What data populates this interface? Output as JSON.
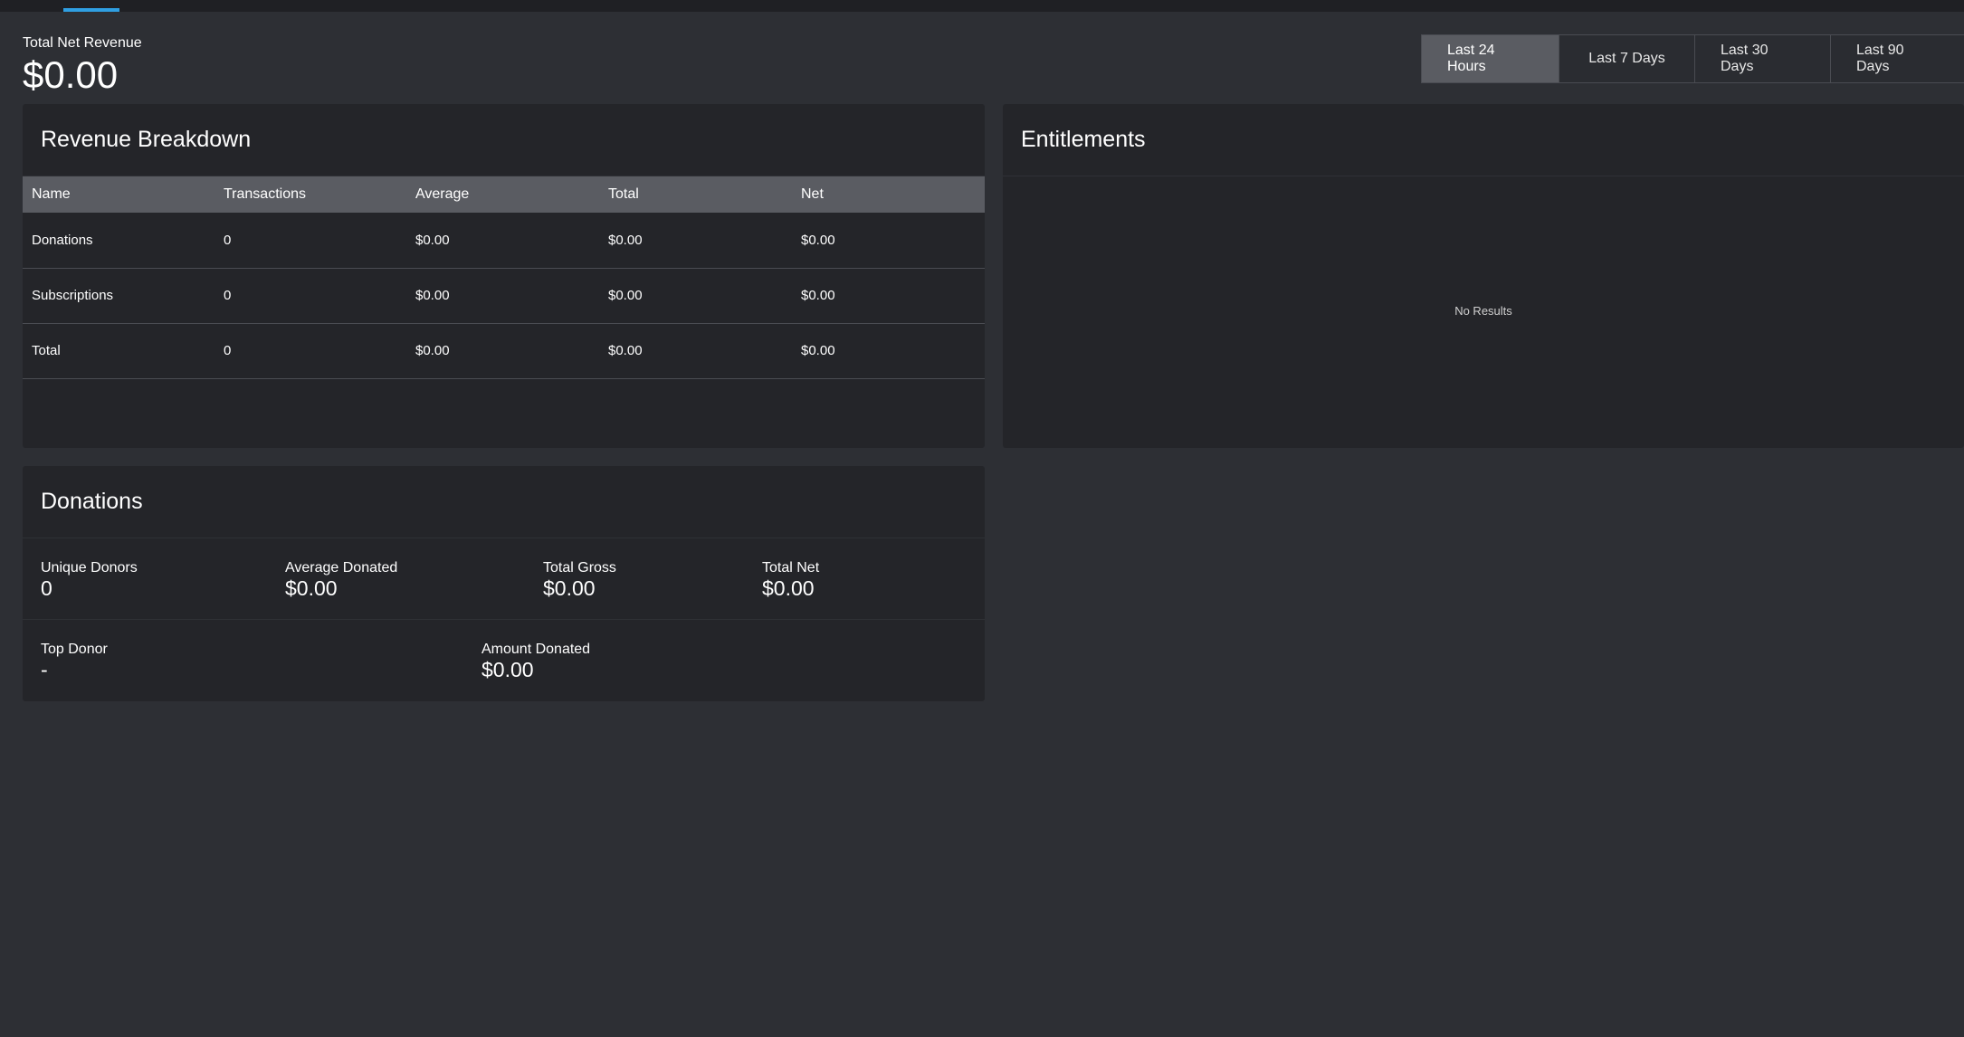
{
  "summary": {
    "label": "Total Net Revenue",
    "value": "$0.00"
  },
  "range": {
    "options": [
      "Last 24 Hours",
      "Last 7 Days",
      "Last 30 Days",
      "Last 90 Days"
    ],
    "selected": "Last 24 Hours"
  },
  "revenue": {
    "title": "Revenue Breakdown",
    "columns": [
      "Name",
      "Transactions",
      "Average",
      "Total",
      "Net"
    ],
    "rows": [
      [
        "Donations",
        "0",
        "$0.00",
        "$0.00",
        "$0.00"
      ],
      [
        "Subscriptions",
        "0",
        "$0.00",
        "$0.00",
        "$0.00"
      ],
      [
        "Total",
        "0",
        "$0.00",
        "$0.00",
        "$0.00"
      ]
    ]
  },
  "entitlements": {
    "title": "Entitlements",
    "empty_text": "No Results"
  },
  "donations": {
    "title": "Donations",
    "unique_donors_label": "Unique Donors",
    "unique_donors_value": "0",
    "average_donated_label": "Average Donated",
    "average_donated_value": "$0.00",
    "total_gross_label": "Total Gross",
    "total_gross_value": "$0.00",
    "total_net_label": "Total Net",
    "total_net_value": "$0.00",
    "top_donor_label": "Top Donor",
    "top_donor_value": "-",
    "amount_donated_label": "Amount Donated",
    "amount_donated_value": "$0.00"
  },
  "colors": {
    "background": "#2d2f34",
    "panel": "#242529",
    "table_header": "#5a5c62",
    "accent": "#2f9fe2"
  }
}
